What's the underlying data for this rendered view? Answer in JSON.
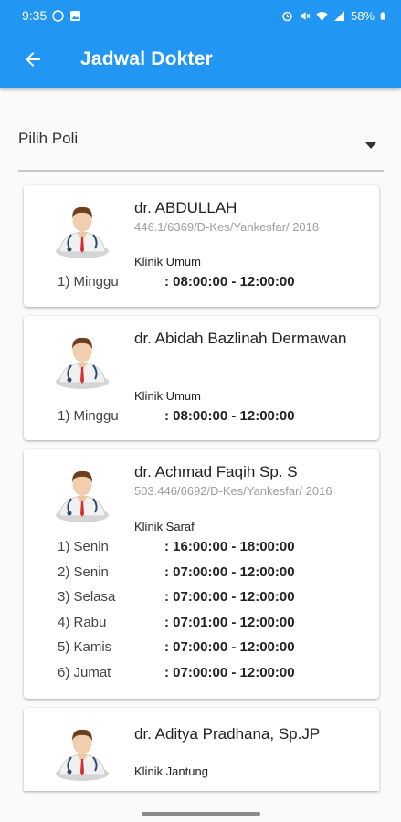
{
  "status_bar": {
    "time": "9:35",
    "battery": "58%"
  },
  "app_bar": {
    "title": "Jadwal Dokter"
  },
  "filter": {
    "label": "Pilih Poli"
  },
  "doctors": [
    {
      "name": "dr. ABDULLAH",
      "sip": "446.1/6369/D-Kes/Yankesfar/ 2018",
      "klinik": "Klinik Umum",
      "schedule": [
        {
          "day": "1) Minggu",
          "hours": ": 08:00:00 - 12:00:00"
        }
      ]
    },
    {
      "name": "dr. Abidah Bazlinah Dermawan",
      "sip": "",
      "klinik": "Klinik Umum",
      "schedule": [
        {
          "day": "1) Minggu",
          "hours": ": 08:00:00 - 12:00:00"
        }
      ]
    },
    {
      "name": "dr. Achmad Faqih Sp. S",
      "sip": "503.446/6692/D-Kes/Yankesfar/ 2016",
      "klinik": "Klinik Saraf",
      "schedule": [
        {
          "day": "1) Senin",
          "hours": ": 16:00:00 - 18:00:00"
        },
        {
          "day": "2) Senin",
          "hours": ": 07:00:00 - 12:00:00"
        },
        {
          "day": "3) Selasa",
          "hours": ": 07:00:00 - 12:00:00"
        },
        {
          "day": "4) Rabu",
          "hours": ": 07:01:00 - 12:00:00"
        },
        {
          "day": "5) Kamis",
          "hours": ": 07:00:00 - 12:00:00"
        },
        {
          "day": "6) Jumat",
          "hours": ": 07:00:00 - 12:00:00"
        }
      ]
    },
    {
      "name": "dr. Aditya Pradhana, Sp.JP",
      "sip": "",
      "klinik": "Klinik Jantung",
      "schedule": []
    }
  ],
  "colors": {
    "primary": "#2196f3",
    "background": "#fafafa",
    "card": "#ffffff",
    "muted_text": "#9e9e9e"
  }
}
